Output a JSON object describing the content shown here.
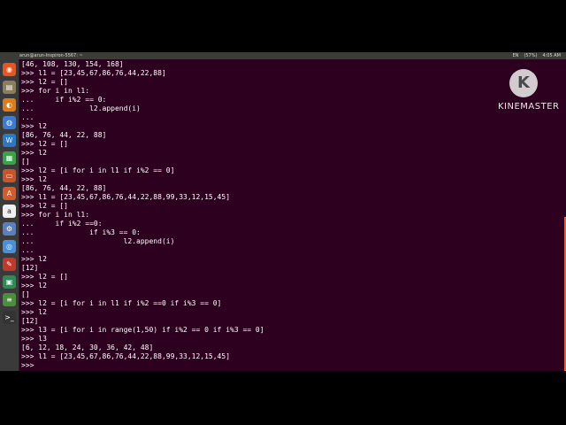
{
  "window": {
    "title": "arun@arun-Inspiron-5567: ~",
    "tray": [
      "EN",
      "(57%)",
      "4:05 AM"
    ]
  },
  "launcher": {
    "items": [
      {
        "icon": "ubuntu-dash-icon",
        "glyph": "◉",
        "color": "#e95420"
      },
      {
        "icon": "files-icon",
        "glyph": "▤",
        "color": "#8a7f5d"
      },
      {
        "icon": "firefox-icon",
        "glyph": "◐",
        "color": "#e07b1a"
      },
      {
        "icon": "chrome-icon",
        "glyph": "◍",
        "color": "#3a7bd5"
      },
      {
        "icon": "libreoffice-writer-icon",
        "glyph": "W",
        "color": "#2a78c9"
      },
      {
        "icon": "libreoffice-calc-icon",
        "glyph": "▦",
        "color": "#39a34a"
      },
      {
        "icon": "libreoffice-impress-icon",
        "glyph": "▭",
        "color": "#c9532a"
      },
      {
        "icon": "software-center-icon",
        "glyph": "A",
        "color": "#d65a2a"
      },
      {
        "icon": "amazon-icon",
        "glyph": "a",
        "color": "#f0f0f0"
      },
      {
        "icon": "settings-icon",
        "glyph": "⚙",
        "color": "#5a7fc0"
      },
      {
        "icon": "chromium-icon",
        "glyph": "◎",
        "color": "#4a90d9"
      },
      {
        "icon": "document-viewer-icon",
        "glyph": "✎",
        "color": "#c0392b"
      },
      {
        "icon": "image-viewer-icon",
        "glyph": "▣",
        "color": "#2e8b57"
      },
      {
        "icon": "text-editor-icon",
        "glyph": "≡",
        "color": "#4b8f3a"
      },
      {
        "icon": "terminal-icon",
        "glyph": ">_",
        "color": "#333333"
      }
    ]
  },
  "terminal": {
    "lines": [
      "[46, 108, 130, 154, 168]",
      ">>> l1 = [23,45,67,86,76,44,22,88]",
      ">>> l2 = []",
      ">>> for i in l1:",
      "...     if i%2 == 0:",
      "...             l2.append(i)",
      "...",
      ">>> l2",
      "[86, 76, 44, 22, 88]",
      ">>> l2 = []",
      ">>> l2",
      "[]",
      ">>> l2 = [i for i in l1 if i%2 == 0]",
      ">>> l2",
      "[86, 76, 44, 22, 88]",
      ">>> l1 = [23,45,67,86,76,44,22,88,99,33,12,15,45]",
      ">>> l2 = []",
      ">>> for i in l1:",
      "...     if i%2 ==0:",
      "...             if i%3 == 0:",
      "...                     l2.append(i)",
      "...",
      ">>> l2",
      "[12]",
      ">>> l2 = []",
      ">>> l2",
      "[]",
      ">>> l2 = [i for i in l1 if i%2 ==0 if i%3 == 0]",
      ">>> l2",
      "[12]",
      ">>> l3 = [i for i in range(1,50) if i%2 == 0 if i%3 == 0]",
      ">>> l3",
      "[6, 12, 18, 24, 30, 36, 42, 48]",
      ">>> l1 = [23,45,67,86,76,44,22,88,99,33,12,15,45]",
      ">>> "
    ]
  },
  "watermark": {
    "logo_letter": "K",
    "text": "KINEMASTER"
  }
}
